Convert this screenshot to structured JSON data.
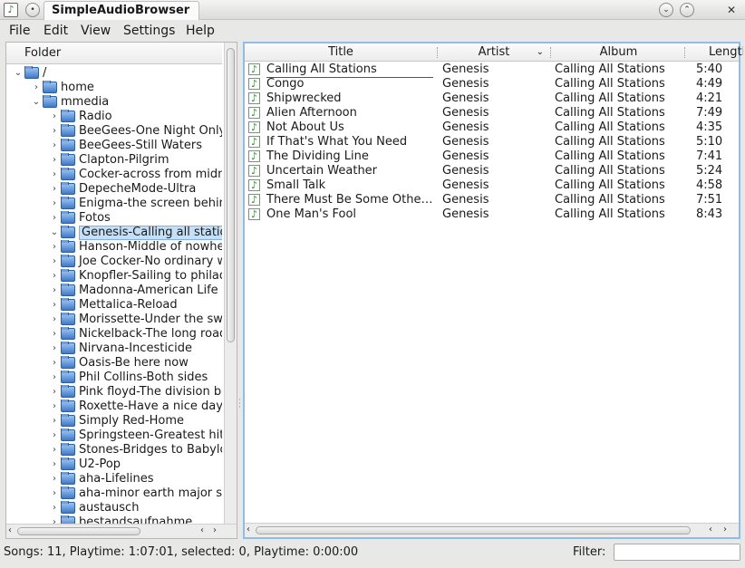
{
  "window": {
    "title": "SimpleAudioBrowser",
    "minimize_glyph": "⌄",
    "maximize_glyph": "⌃",
    "close_glyph": "✕"
  },
  "menu": [
    "File",
    "Edit",
    "View",
    "Settings",
    "Help"
  ],
  "folder_panel": {
    "header": "Folder",
    "tree": [
      {
        "label": "/",
        "depth": 0,
        "expanded": true
      },
      {
        "label": "home",
        "depth": 1,
        "expanded": false
      },
      {
        "label": "mmedia",
        "depth": 1,
        "expanded": true
      },
      {
        "label": "Radio",
        "depth": 2,
        "expanded": false
      },
      {
        "label": "BeeGees-One Night Only",
        "depth": 2,
        "expanded": false
      },
      {
        "label": "BeeGees-Still Waters",
        "depth": 2,
        "expanded": false
      },
      {
        "label": "Clapton-Pilgrim",
        "depth": 2,
        "expanded": false
      },
      {
        "label": "Cocker-across from midnight",
        "depth": 2,
        "expanded": false
      },
      {
        "label": "DepecheMode-Ultra",
        "depth": 2,
        "expanded": false
      },
      {
        "label": "Enigma-the screen behind the mirror",
        "depth": 2,
        "expanded": false
      },
      {
        "label": "Fotos",
        "depth": 2,
        "expanded": false
      },
      {
        "label": "Genesis-Calling all stations",
        "depth": 2,
        "expanded": true,
        "selected": true
      },
      {
        "label": "Hanson-Middle of nowhere",
        "depth": 2,
        "expanded": false
      },
      {
        "label": "Joe Cocker-No ordinary world",
        "depth": 2,
        "expanded": false
      },
      {
        "label": "Knopfler-Sailing to philadelphia",
        "depth": 2,
        "expanded": false
      },
      {
        "label": "Madonna-American Life",
        "depth": 2,
        "expanded": false
      },
      {
        "label": "Mettalica-Reload",
        "depth": 2,
        "expanded": false
      },
      {
        "label": "Morissette-Under the swing",
        "depth": 2,
        "expanded": false
      },
      {
        "label": "Nickelback-The long road",
        "depth": 2,
        "expanded": false
      },
      {
        "label": "Nirvana-Incesticide",
        "depth": 2,
        "expanded": false
      },
      {
        "label": "Oasis-Be here now",
        "depth": 2,
        "expanded": false
      },
      {
        "label": "Phil Collins-Both sides",
        "depth": 2,
        "expanded": false
      },
      {
        "label": "Pink floyd-The division bell",
        "depth": 2,
        "expanded": false
      },
      {
        "label": "Roxette-Have a nice day",
        "depth": 2,
        "expanded": false
      },
      {
        "label": "Simply Red-Home",
        "depth": 2,
        "expanded": false
      },
      {
        "label": "Springsteen-Greatest hits",
        "depth": 2,
        "expanded": false
      },
      {
        "label": "Stones-Bridges to Babylon",
        "depth": 2,
        "expanded": false
      },
      {
        "label": "U2-Pop",
        "depth": 2,
        "expanded": false
      },
      {
        "label": "aha-Lifelines",
        "depth": 2,
        "expanded": false
      },
      {
        "label": "aha-minor earth major sky",
        "depth": 2,
        "expanded": false
      },
      {
        "label": "austausch",
        "depth": 2,
        "expanded": false
      },
      {
        "label": "bestandsaufnahme",
        "depth": 2,
        "expanded": false
      }
    ]
  },
  "songs_table": {
    "columns": [
      "Title",
      "Artist",
      "Album",
      "Length"
    ],
    "sort_column": "Artist",
    "rows": [
      {
        "title": "Calling All Stations",
        "artist": "Genesis",
        "album": "Calling All Stations",
        "length": "5:40"
      },
      {
        "title": "Congo",
        "artist": "Genesis",
        "album": "Calling All Stations",
        "length": "4:49"
      },
      {
        "title": "Shipwrecked",
        "artist": "Genesis",
        "album": "Calling All Stations",
        "length": "4:21"
      },
      {
        "title": "Alien Afternoon",
        "artist": "Genesis",
        "album": "Calling All Stations",
        "length": "7:49"
      },
      {
        "title": "Not About Us",
        "artist": "Genesis",
        "album": "Calling All Stations",
        "length": "4:35"
      },
      {
        "title": "If That's What You Need",
        "artist": "Genesis",
        "album": "Calling All Stations",
        "length": "5:10"
      },
      {
        "title": "The Dividing Line",
        "artist": "Genesis",
        "album": "Calling All Stations",
        "length": "7:41"
      },
      {
        "title": "Uncertain Weather",
        "artist": "Genesis",
        "album": "Calling All Stations",
        "length": "5:24"
      },
      {
        "title": "Small Talk",
        "artist": "Genesis",
        "album": "Calling All Stations",
        "length": "4:58"
      },
      {
        "title": "There Must Be Some Other Way",
        "artist": "Genesis",
        "album": "Calling All Stations",
        "length": "7:51"
      },
      {
        "title": "One Man's Fool",
        "artist": "Genesis",
        "album": "Calling All Stations",
        "length": "8:43"
      }
    ]
  },
  "status": {
    "text": "Songs: 11, Playtime: 1:07:01,  selected: 0, Playtime: 0:00:00",
    "filter_label": "Filter:",
    "filter_value": ""
  }
}
